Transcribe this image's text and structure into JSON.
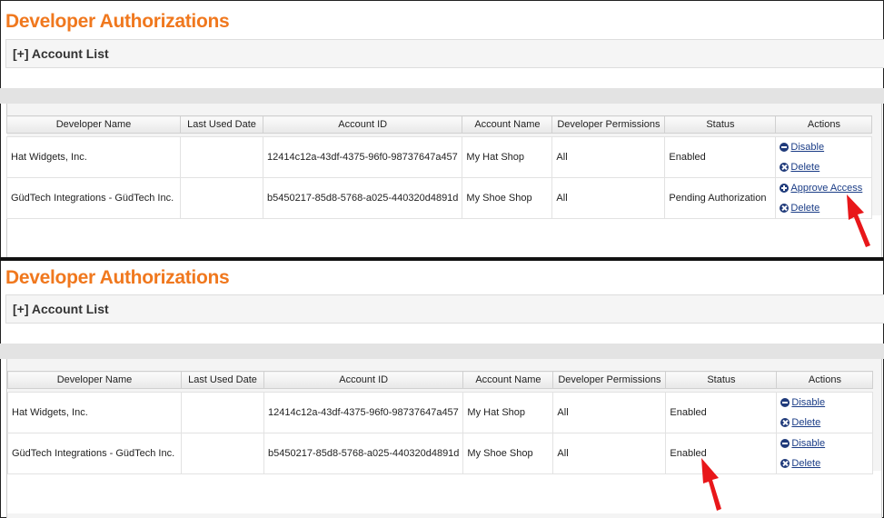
{
  "page_title": "Developer Authorizations",
  "account_list_label": "[+] Account List",
  "columns": [
    "Developer Name",
    "Last Used Date",
    "Account ID",
    "Account Name",
    "Developer Permissions",
    "Status",
    "Actions"
  ],
  "before": {
    "rows": [
      {
        "developer_name": "Hat Widgets, Inc.",
        "last_used_date": "",
        "account_id": "12414c12a-43df-4375-96f0-98737647a457",
        "account_name": "My Hat Shop",
        "permissions": "All",
        "status": "Enabled",
        "actions": [
          {
            "label": "Disable",
            "icon": "minus-circle-icon"
          },
          {
            "label": "Delete",
            "icon": "x-circle-icon"
          }
        ]
      },
      {
        "developer_name": "GüdTech Integrations - GüdTech Inc.",
        "last_used_date": "",
        "account_id": "b5450217-85d8-5768-a025-440320d4891d",
        "account_name": "My Shoe Shop",
        "permissions": "All",
        "status": "Pending Authorization",
        "actions": [
          {
            "label": "Approve Access",
            "icon": "plus-circle-icon"
          },
          {
            "label": "Delete",
            "icon": "x-circle-icon"
          }
        ]
      }
    ]
  },
  "after": {
    "rows": [
      {
        "developer_name": "Hat Widgets, Inc.",
        "last_used_date": "",
        "account_id": "12414c12a-43df-4375-96f0-98737647a457",
        "account_name": "My Hat Shop",
        "permissions": "All",
        "status": "Enabled",
        "actions": [
          {
            "label": "Disable",
            "icon": "minus-circle-icon"
          },
          {
            "label": "Delete",
            "icon": "x-circle-icon"
          }
        ]
      },
      {
        "developer_name": "GüdTech Integrations - GüdTech Inc.",
        "last_used_date": "",
        "account_id": "b5450217-85d8-5768-a025-440320d4891d",
        "account_name": "My Shoe Shop",
        "permissions": "All",
        "status": "Enabled",
        "actions": [
          {
            "label": "Disable",
            "icon": "minus-circle-icon"
          },
          {
            "label": "Delete",
            "icon": "x-circle-icon"
          }
        ]
      }
    ]
  },
  "colors": {
    "title": "#f0781e",
    "link": "#1a3c86",
    "icon": "#1f3a7a",
    "annotation_arrow": "#e8171a"
  }
}
